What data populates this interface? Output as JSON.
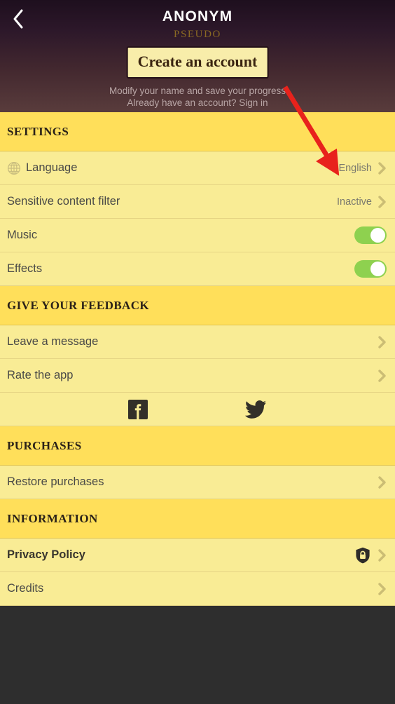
{
  "header": {
    "back_icon": "chevron-left-icon",
    "title": "ANONYM",
    "pseudo": "PSEUDO",
    "create_account_label": "Create an account",
    "subtitle_line1": "Modify your name and save your progress",
    "subtitle_line2": "Already have an account? Sign in"
  },
  "annotation": {
    "arrow_color": "#e8221c"
  },
  "colors": {
    "section_header_bg": "#ffdf5a",
    "row_bg": "#f9ec95",
    "toggle_on": "#8ed14f",
    "footer_bg": "#2e2e2e",
    "chevron": "#cbbd74"
  },
  "sections": [
    {
      "title": "SETTINGS",
      "rows": [
        {
          "label": "Language",
          "icon": "globe-icon",
          "value": "English",
          "type": "link"
        },
        {
          "label": "Sensitive content filter",
          "value": "Inactive",
          "type": "link"
        },
        {
          "label": "Music",
          "type": "toggle",
          "toggle_on": true
        },
        {
          "label": "Effects",
          "type": "toggle",
          "toggle_on": true
        }
      ]
    },
    {
      "title": "GIVE YOUR FEEDBACK",
      "rows": [
        {
          "label": "Leave a message",
          "type": "link"
        },
        {
          "label": "Rate the app",
          "type": "link"
        }
      ],
      "social": [
        {
          "name": "facebook-icon"
        },
        {
          "name": "twitter-icon"
        }
      ]
    },
    {
      "title": "PURCHASES",
      "rows": [
        {
          "label": "Restore purchases",
          "type": "link"
        }
      ]
    },
    {
      "title": "INFORMATION",
      "rows": [
        {
          "label": "Privacy Policy",
          "type": "link",
          "bold": true,
          "badge": "shield-lock-icon"
        },
        {
          "label": "Credits",
          "type": "link"
        }
      ]
    }
  ]
}
